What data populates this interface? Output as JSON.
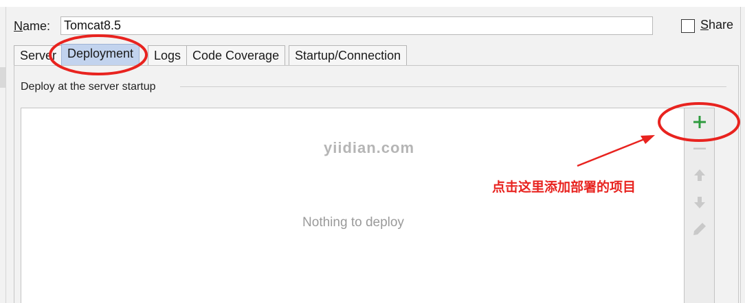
{
  "form": {
    "name_label_mnemonic": "N",
    "name_label_rest": "ame:",
    "name_value": "Tomcat8.5",
    "share_label_mnemonic": "S",
    "share_label_rest": "hare",
    "share_checked": false
  },
  "tabs": [
    {
      "label": "Server",
      "active": false
    },
    {
      "label": "Deployment",
      "active": true
    },
    {
      "label": "Logs",
      "active": false
    },
    {
      "label": "Code Coverage",
      "active": false
    },
    {
      "label": "Startup/Connection",
      "active": false
    }
  ],
  "deploy_group": {
    "title": "Deploy at the server startup",
    "empty_text": "Nothing to deploy"
  },
  "toolbar": {
    "buttons": [
      {
        "icon": "plus-icon",
        "enabled": true,
        "color": "#2e9b3e"
      },
      {
        "icon": "minus-icon",
        "enabled": false
      },
      {
        "icon": "arrow-up-icon",
        "enabled": false
      },
      {
        "icon": "arrow-down-icon",
        "enabled": false
      },
      {
        "icon": "pencil-icon",
        "enabled": false
      }
    ]
  },
  "annotation": {
    "text": "点击这里添加部署的项目",
    "color": "#e8231f"
  },
  "watermark": "yiidian.com"
}
